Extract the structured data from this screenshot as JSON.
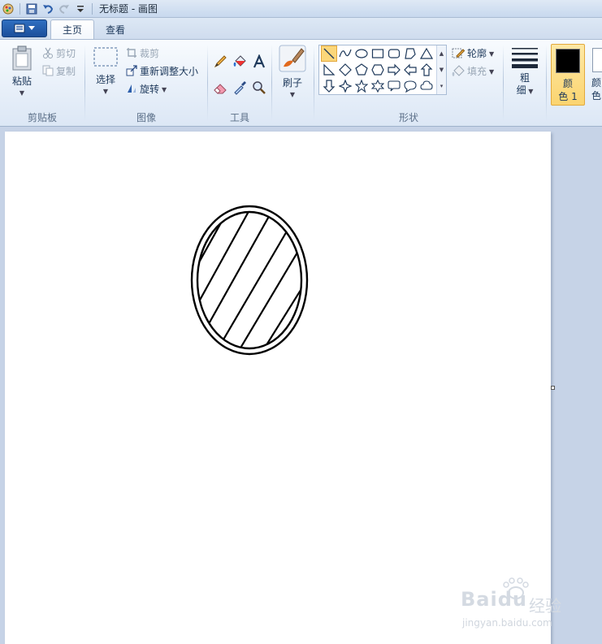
{
  "window": {
    "title": "无标题 - 画图"
  },
  "tabs": [
    {
      "label": "主页",
      "active": true
    },
    {
      "label": "查看",
      "active": false
    }
  ],
  "ribbon": {
    "clipboard": {
      "label": "剪贴板",
      "paste": "粘贴",
      "cut": "剪切",
      "copy": "复制"
    },
    "image": {
      "label": "图像",
      "select": "选择",
      "crop": "裁剪",
      "resize": "重新调整大小",
      "rotate": "旋转"
    },
    "tools": {
      "label": "工具"
    },
    "brushes": {
      "label": "刷子"
    },
    "shapes": {
      "label": "形状",
      "outline": "轮廓",
      "fill": "填充"
    },
    "size": {
      "label_line1": "粗",
      "label_line2": "细"
    },
    "color1": {
      "label_line1": "颜",
      "label_line2": "色 1",
      "value": "#000000"
    },
    "color2": {
      "label_line1": "颜",
      "label_line2": "色"
    }
  },
  "watermark": {
    "brand": "Baidu",
    "cn": "经验",
    "url": "jingyan.baidu.com"
  },
  "colors": {
    "accent": "#fbd470",
    "ribbon_bg": "#e4edf8",
    "workspace_bg": "#c6d3e7"
  }
}
